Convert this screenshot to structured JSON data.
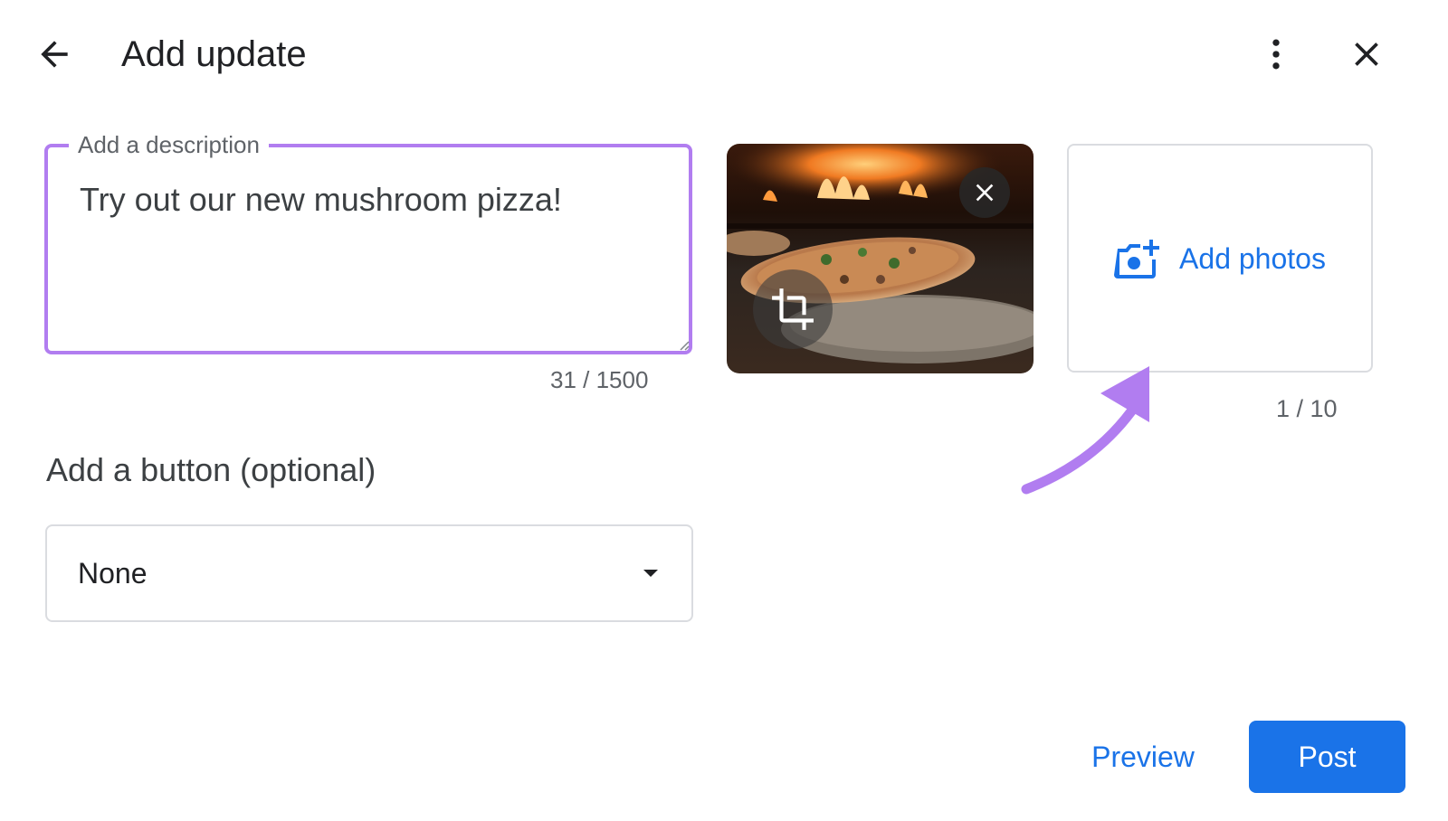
{
  "header": {
    "title": "Add update",
    "back_icon": "arrow-back-icon",
    "more_icon": "more-vert-icon",
    "close_icon": "close-icon"
  },
  "description": {
    "label": "Add a description",
    "value": "Try out our new mushroom pizza!",
    "char_count": "31 / 1500",
    "accent_color": "#b17df0"
  },
  "photos": {
    "thumbnail_subject": "mushroom pizza in wood-fired oven",
    "remove_icon": "close-icon",
    "crop_icon": "crop-icon",
    "add_label": "Add photos",
    "add_icon": "add-photo-camera-icon",
    "count": "1 / 10"
  },
  "button_section": {
    "heading": "Add a button (optional)",
    "selected": "None"
  },
  "footer": {
    "preview_label": "Preview",
    "post_label": "Post",
    "primary_color": "#1a73e8"
  }
}
